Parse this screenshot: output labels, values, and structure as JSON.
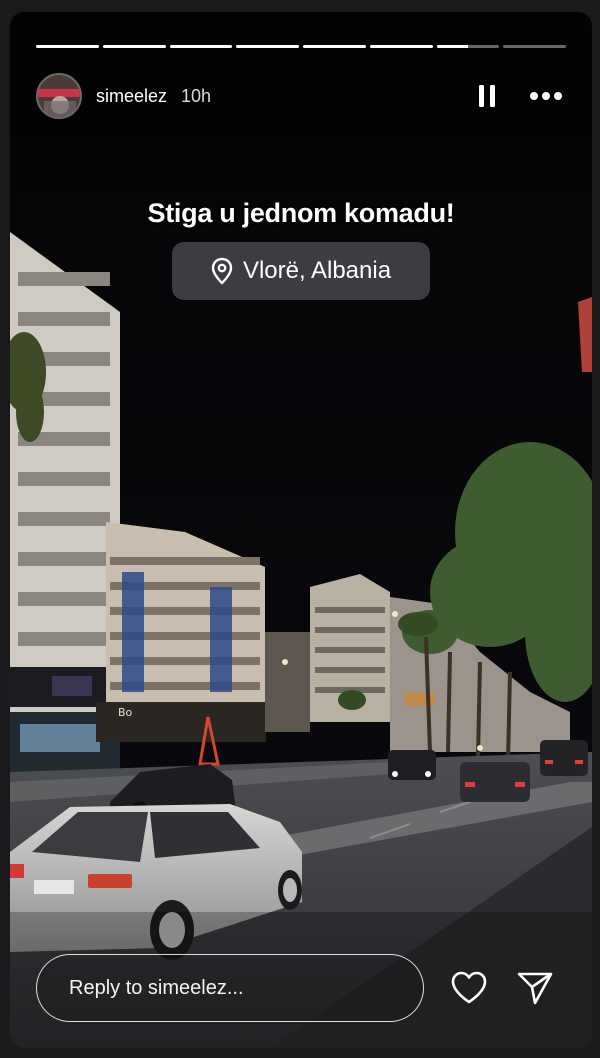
{
  "story": {
    "username": "simeelez",
    "time_ago": "10h",
    "progress": {
      "segments": 8,
      "completed": 6,
      "current_fraction": 0.5
    },
    "caption": "Stiga u jednom komadu!",
    "location": "Vlorë, Albania",
    "photo_signs": [
      "Bo"
    ]
  },
  "controls": {
    "pause_icon": "pause-icon",
    "more_icon": "more-icon",
    "reply_placeholder": "Reply to simeelez...",
    "like_icon": "heart-icon",
    "share_icon": "send-icon"
  }
}
